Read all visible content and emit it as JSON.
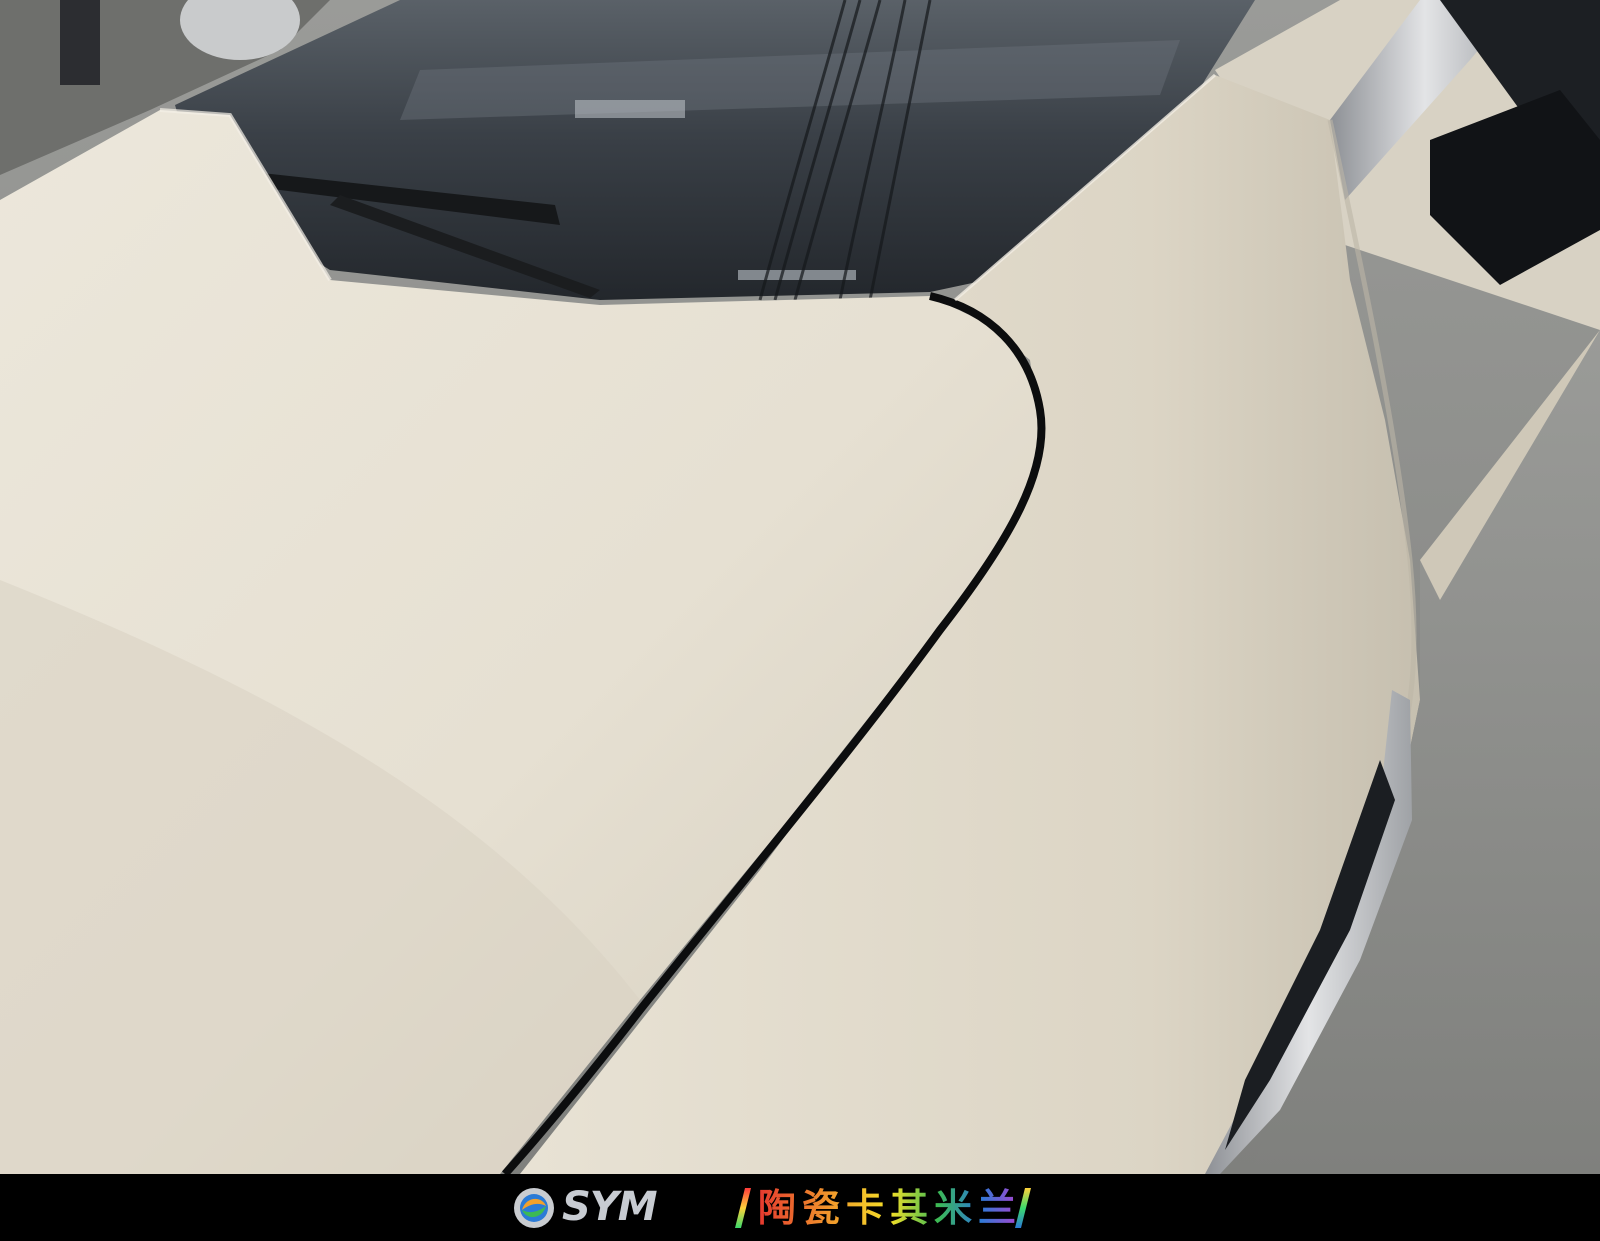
{
  "watermark": {
    "brand": "SYM",
    "title": "陶瓷卡其米兰"
  },
  "colors": {
    "paint": "#e7e1d3",
    "paint_shadow": "#b9b2a2",
    "glass": "#2b3036",
    "asphalt": "#8e8f8c",
    "bar": "#000000"
  }
}
